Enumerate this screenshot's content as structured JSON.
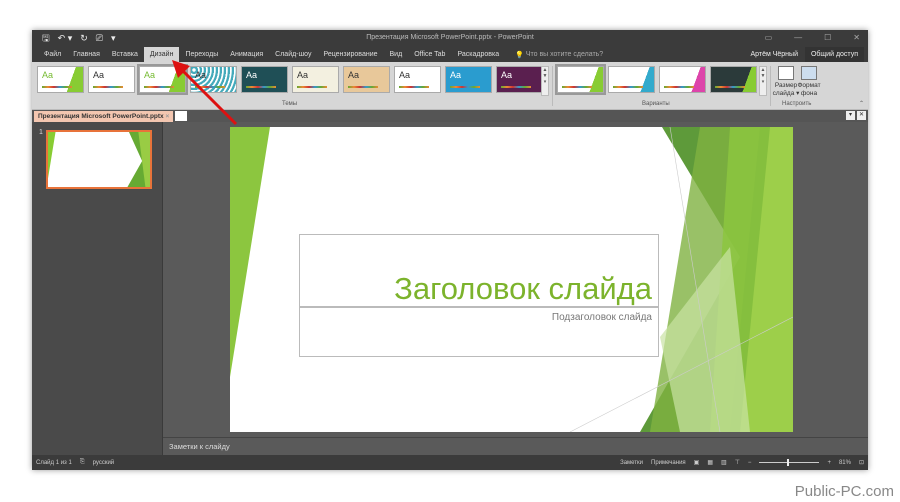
{
  "title": "Презентация Microsoft PowerPoint.pptx - PowerPoint",
  "qa": {
    "save": "🖫",
    "undo": "↶ ▾",
    "redo": "↻",
    "present": "⎚",
    "more": "▾"
  },
  "window_controls": [
    "▭",
    "—",
    "☐",
    "✕"
  ],
  "tabs": [
    "Файл",
    "Главная",
    "Вставка",
    "Дизайн",
    "Переходы",
    "Анимация",
    "Слайд-шоу",
    "Рецензирование",
    "Вид",
    "Office Tab",
    "Раскадровка"
  ],
  "active_tab": "Дизайн",
  "tell_me": "Что вы хотите сделать?",
  "user": "Артём Чёрный",
  "share": "Общий доступ",
  "themes": [
    "Aa",
    "Aa",
    "Aa",
    "Aa",
    "Aa",
    "Aa",
    "Aa",
    "Aa",
    "Aa",
    "Aa"
  ],
  "themes_group": "Темы",
  "variants_group": "Варианты",
  "customize": {
    "slide_size": "Размер слайда ▾",
    "format_bg": "Формат фона",
    "group": "Настроить"
  },
  "doc_tab": "Презентация Microsoft PowerPoint.pptx",
  "doc_tab_close": "×",
  "slide_number": "1",
  "slide": {
    "title": "Заголовок слайда",
    "subtitle": "Подзаголовок слайда"
  },
  "notes": "Заметки к слайду",
  "status": {
    "slide": "Слайд 1 из 1",
    "lang": "русский",
    "notes": "Заметки",
    "comments": "Примечания",
    "zoom": "81%",
    "zoom_value": 81
  },
  "watermark": "Public-PC.com"
}
